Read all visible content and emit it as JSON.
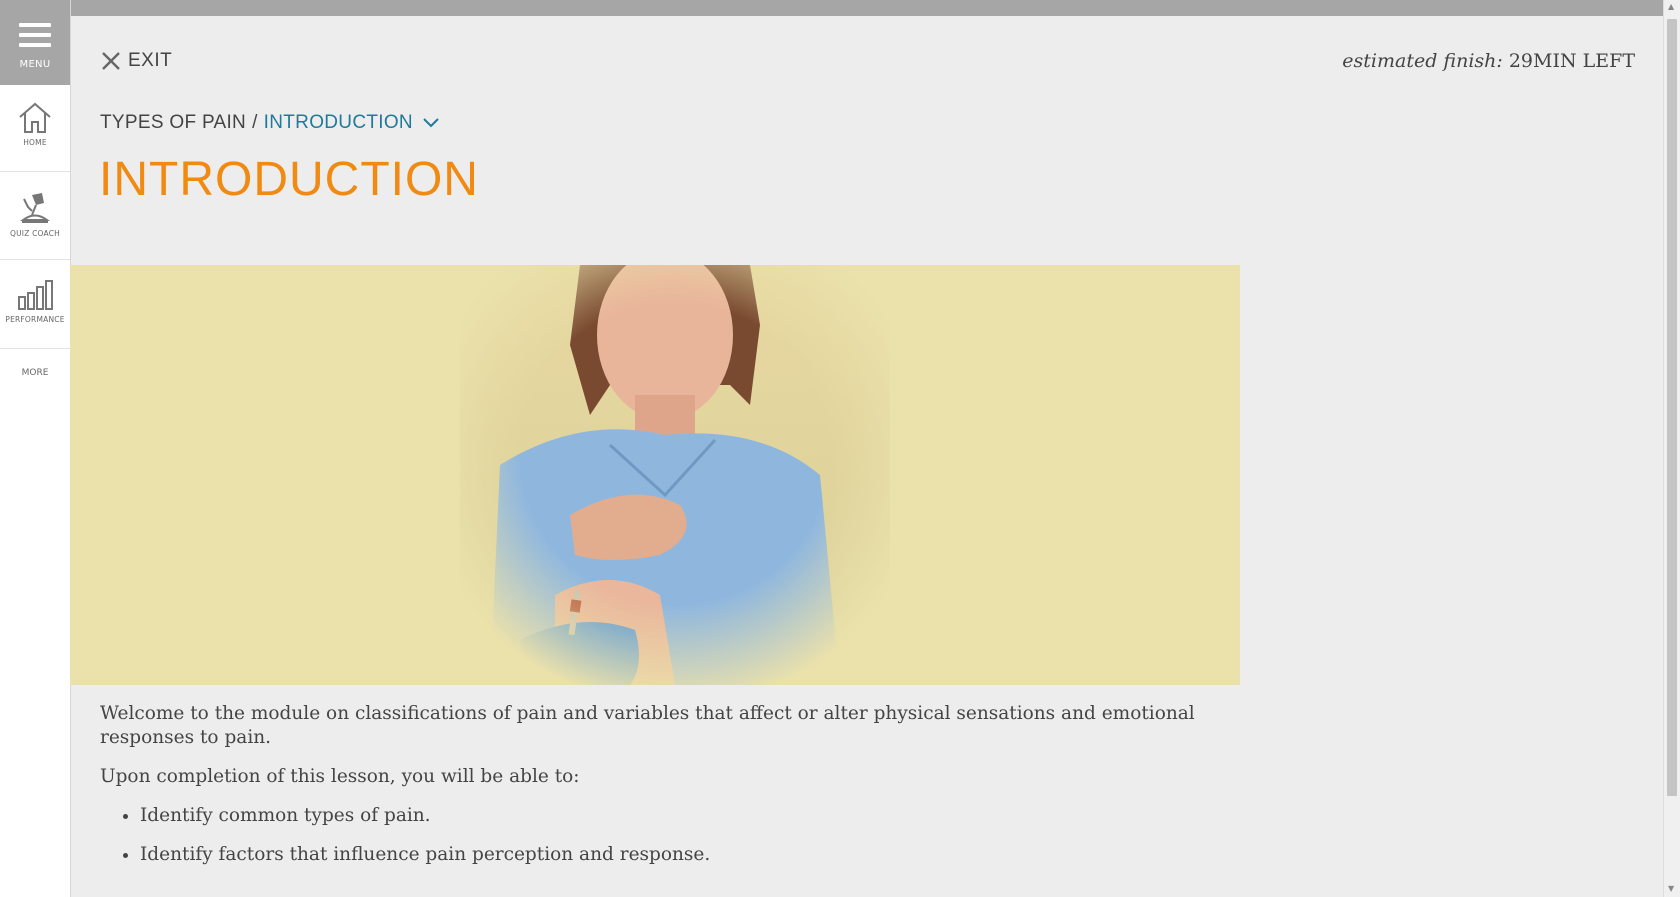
{
  "sidebar": {
    "menu_label": "MENU",
    "items": [
      {
        "label": "HOME",
        "icon": "home-icon"
      },
      {
        "label": "QUIZ COACH",
        "icon": "quiz-coach-icon"
      },
      {
        "label": "PERFORMANCE",
        "icon": "bar-chart-icon"
      }
    ],
    "more_label": "MORE"
  },
  "header": {
    "exit_label": "EXIT",
    "estimated_prefix": "estimated finish:",
    "estimated_value": "29MIN LEFT"
  },
  "breadcrumb": {
    "parent": "TYPES OF PAIN",
    "separator": "/",
    "current": "INTRODUCTION"
  },
  "page": {
    "title": "INTRODUCTION",
    "intro": "Welcome to the module on classifications of pain and variables that affect or alter physical sensations and emotional responses to pain.",
    "objectives_lead": "Upon completion of this lesson, you will be able to:",
    "objectives": [
      "Identify common types of pain.",
      "Identify factors that influence pain perception and response."
    ]
  },
  "colors": {
    "accent_title": "#f08a12",
    "link": "#1f7a9c",
    "hero_background": "#ebe1ab",
    "menu_background": "#a6a6a6"
  }
}
